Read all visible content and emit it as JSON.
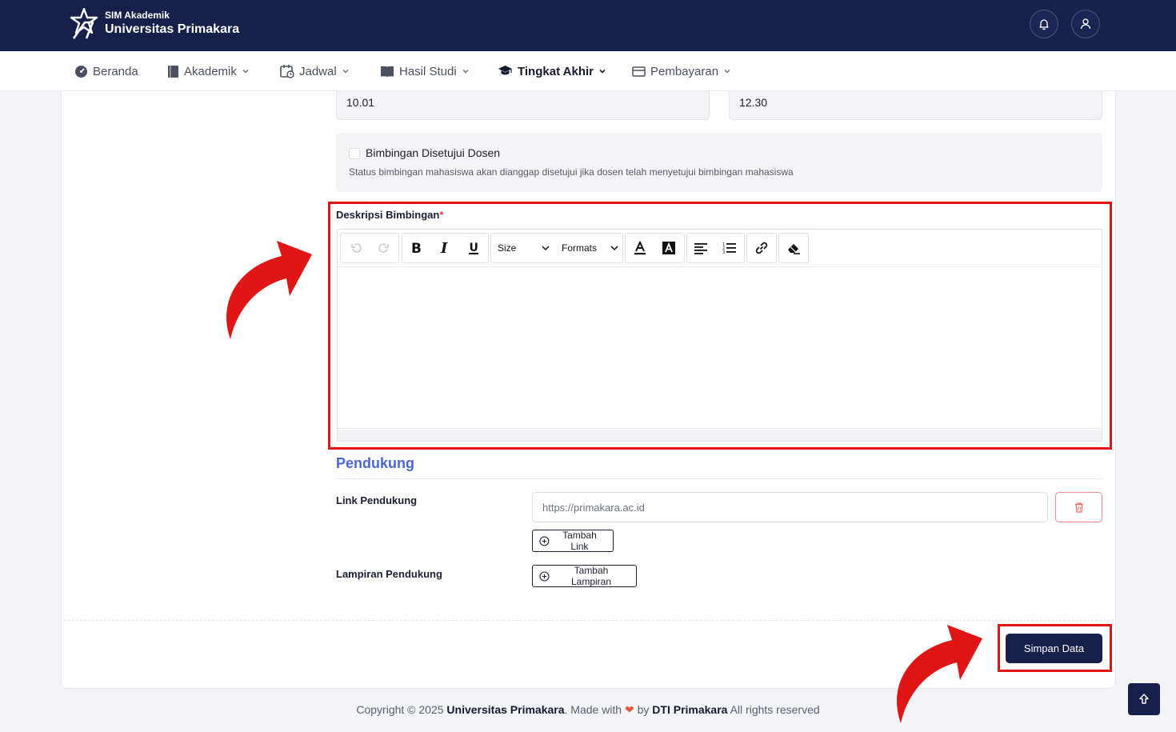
{
  "header": {
    "subtitle": "SIM Akademik",
    "title": "Universitas Primakara"
  },
  "nav": {
    "items": [
      {
        "label": "Beranda",
        "icon": "dashboard-icon"
      },
      {
        "label": "Akademik",
        "icon": "book-icon"
      },
      {
        "label": "Jadwal",
        "icon": "calendar-clock-icon"
      },
      {
        "label": "Hasil Studi",
        "icon": "open-book-icon"
      },
      {
        "label": "Tingkat Akhir",
        "icon": "graduation-cap-icon",
        "active": true
      },
      {
        "label": "Pembayaran",
        "icon": "wallet-icon"
      }
    ]
  },
  "form": {
    "start_time": "10.01",
    "end_time": "12.30",
    "approval": {
      "label": "Bimbingan Disetujui Dosen",
      "help": "Status bimbingan mahasiswa akan dianggap disetujui jika dosen telah menyetujui bimbingan mahasiswa",
      "checked": false
    },
    "description": {
      "label": "Deskripsi Bimbingan",
      "required_mark": "*",
      "toolbar": {
        "size_label": "Size",
        "formats_label": "Formats"
      }
    },
    "support": {
      "section_title": "Pendukung",
      "link_label": "Link Pendukung",
      "link_placeholder": "https://primakara.ac.id",
      "add_link_label": "Tambah Link",
      "attachment_label": "Lampiran Pendukung",
      "add_attachment_label": "Tambah Lampiran"
    },
    "save_label": "Simpan Data"
  },
  "footer": {
    "copyright": "Copyright © 2025",
    "org": "Universitas Primakara",
    "made_with": ". Made with",
    "by": "by",
    "team": "DTI Primakara",
    "rights": "All rights reserved"
  },
  "colors": {
    "primary": "#17204a",
    "section_title": "#4a67d6",
    "highlight": "#e01515",
    "required": "#e53935"
  }
}
